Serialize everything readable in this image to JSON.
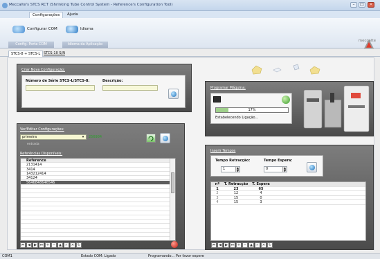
{
  "titlebar": {
    "title": "Meccalte's STCS RCT (Shrinking Tube Control System - Reference's Configuration Tool)"
  },
  "ribbon": {
    "tabs": [
      "Configurações",
      "Ajuda"
    ],
    "buttons": [
      {
        "label": "Configurar COM",
        "icon": "com-port-icon"
      },
      {
        "label": "Idioma",
        "icon": "language-icon"
      }
    ],
    "groups": [
      "Config. Porta COM",
      "Idioma da Aplicação"
    ],
    "logo_text": "meccalte"
  },
  "doc_tabs": [
    "STCS-8 + STCS-L",
    "STCS-10 S/N"
  ],
  "new_config": {
    "title": "Criar Nova Configuração:",
    "serial_label": "Número de Série STCS-L/STCS-8:",
    "desc_label": "Descrição:"
  },
  "view_edit": {
    "title": "Ver/Editar Configurações:",
    "combo_value": "primeira",
    "combo_extra": "256984",
    "sublabel": "entrada"
  },
  "references": {
    "title": "Referências Disponíveis:",
    "header": "Reference",
    "rows": [
      "2131414",
      "3414",
      "143212414",
      "34124",
      "5646848646546"
    ],
    "selected_index": 4
  },
  "program": {
    "title": "Programar Máquina:",
    "progress_text": "17%",
    "progress_value": 17,
    "status": "Estabelecendo Ligação..."
  },
  "times": {
    "title": "Inserir Tempos",
    "retraction_label": "Tempo Retracção:",
    "retraction_value": "1",
    "wait_label": "Tempo Espera:",
    "wait_value": "0",
    "columns": [
      "nº",
      "T. Retracção",
      "T. Espera"
    ],
    "rows": [
      [
        "1",
        "23",
        "65"
      ],
      [
        "2",
        "12",
        "4"
      ],
      [
        "3",
        "15",
        "0"
      ],
      [
        "4",
        "15",
        "3"
      ]
    ]
  },
  "status": {
    "com": "COM1",
    "connection": "Estado COM: Ligado",
    "programming": "Programando... Por favor espere"
  }
}
